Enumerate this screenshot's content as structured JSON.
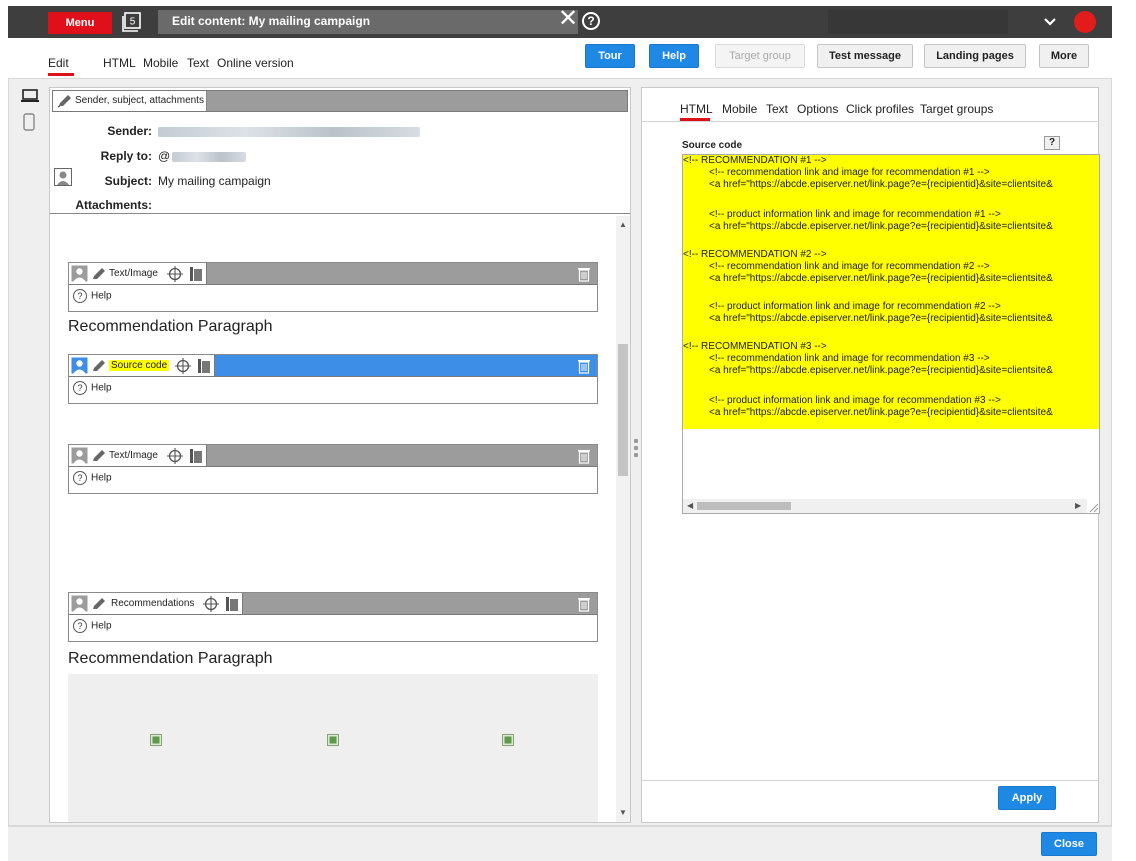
{
  "topbar": {
    "menu_label": "Menu",
    "tab_count": "5",
    "window_title": "Edit content: My mailing campaign",
    "help_glyph": "?",
    "close_glyph": "✕",
    "icons": [
      "tab-count-icon",
      "close-icon",
      "help-icon",
      "chevron-down-icon",
      "user-status-dot"
    ],
    "accent_color": "#e0101a"
  },
  "toolbar": {
    "tabs": [
      "Edit",
      "HTML",
      "Mobile",
      "Text",
      "Online version"
    ],
    "active_tab": "Edit",
    "buttons": {
      "tour": "Tour",
      "help": "Help",
      "target_group": "Target group",
      "test_message": "Test message",
      "landing_pages": "Landing pages",
      "more": "More"
    },
    "button_color": "#1e88e5"
  },
  "device_icons": [
    "desktop-icon",
    "mobile-icon"
  ],
  "header_section": {
    "bar_label": "Sender, subject, attachments",
    "sender_label": "Sender:",
    "reply_to_label": "Reply to:",
    "reply_to_prefix": "@",
    "subject_label": "Subject:",
    "subject_value": "My mailing campaign",
    "attachments_label": "Attachments:"
  },
  "blocks": [
    {
      "label": "Text/Image",
      "help": "Help",
      "selected": false
    },
    {
      "label": "Source code",
      "help": "Help",
      "selected": true
    },
    {
      "label": "Text/Image",
      "help": "Help",
      "selected": false
    },
    {
      "label": "Recommendations",
      "help": "Help",
      "selected": false
    }
  ],
  "paragraphs": [
    "Recommendation Paragraph",
    "Recommendation Paragraph"
  ],
  "right_panel": {
    "tabs": [
      "HTML",
      "Mobile",
      "Text",
      "Options",
      "Click profiles",
      "Target groups"
    ],
    "active_tab": "HTML",
    "source_code_label": "Source code",
    "source_code_help": "?",
    "code_lines": [
      "<!-- RECOMMENDATION #1 -->",
      "<!-- recommendation link and image for recommendation #1 -->",
      "<a href=\"https://abcde.episerver.net/link.page?e={recipientid}&site=clientsite&",
      "",
      "<!-- product information link and image  for recommendation #1 -->",
      "<a href=\"https://abcde.episerver.net/link.page?e={recipientid}&site=clientsite&",
      "",
      "<!-- RECOMMENDATION #2 -->",
      "<!-- recommendation link and image for recommendation #2 -->",
      "<a href=\"https://abcde.episerver.net/link.page?e={recipientid}&site=clientsite&",
      "",
      "<!-- product information link and image  for recommendation #2 -->",
      "<a href=\"https://abcde.episerver.net/link.page?e={recipientid}&site=clientsite&",
      "",
      "<!-- RECOMMENDATION #3 -->",
      "<!-- recommendation link and image for recommendation #3 -->",
      "<a href=\"https://abcde.episerver.net/link.page?e={recipientid}&site=clientsite&",
      "",
      "<!-- product information link and image  for recommendation #3 -->",
      "<a href=\"https://abcde.episerver.net/link.page?e={recipientid}&site=clientsite&"
    ],
    "highlight_color": "#ffff00",
    "apply_label": "Apply"
  },
  "footer": {
    "close_label": "Close"
  }
}
